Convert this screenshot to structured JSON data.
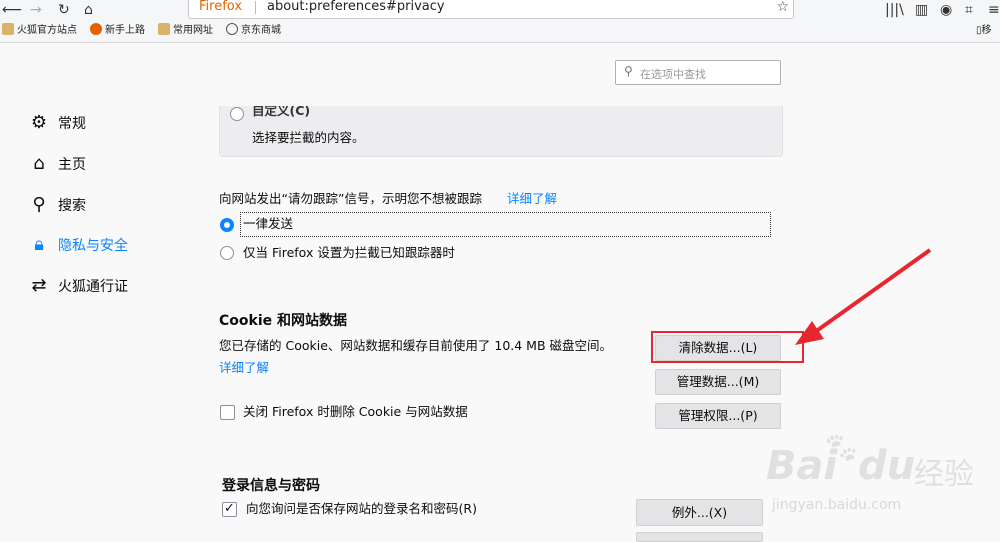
{
  "browser": {
    "brand": "Firefox",
    "url": "about:preferences#privacy",
    "bookmarks": [
      {
        "label": "火狐官方站点",
        "icon": "folder-icon"
      },
      {
        "label": "新手上路",
        "icon": "firefox-icon"
      },
      {
        "label": "常用网址",
        "icon": "folder-icon"
      },
      {
        "label": "京东商城",
        "icon": "globe-icon"
      }
    ],
    "bookmarks_right": "移"
  },
  "search": {
    "placeholder": "在选项中查找"
  },
  "sidebar": {
    "items": [
      {
        "label": "常规",
        "icon": "gear-icon"
      },
      {
        "label": "主页",
        "icon": "home-icon"
      },
      {
        "label": "搜索",
        "icon": "search-icon"
      },
      {
        "label": "隐私与安全",
        "icon": "lock-icon",
        "selected": true
      },
      {
        "label": "火狐通行证",
        "icon": "sync-icon"
      }
    ]
  },
  "blocking": {
    "custom_label": "自定义(C)",
    "custom_desc": "选择要拦截的内容。"
  },
  "dnt": {
    "intro": "向网站发出“请勿跟踪”信号，示明您不想被跟踪",
    "learn_more": "详细了解",
    "option_always": "一律发送",
    "option_only": "仅当 Firefox 设置为拦截已知跟踪器时",
    "selected": "一律发送"
  },
  "cookies": {
    "heading": "Cookie 和网站数据",
    "usage_text": "您已存储的 Cookie、网站数据和缓存目前使用了 10.4 MB 磁盘空间。",
    "learn_more": "详细了解",
    "clear_button": "清除数据...(L)",
    "manage_button": "管理数据...(M)",
    "permissions_button": "管理权限...(P)",
    "delete_on_close": "关闭 Firefox 时删除 Cookie 与网站数据",
    "delete_on_close_checked": false
  },
  "logins": {
    "heading": "登录信息与密码",
    "ask_save": "向您询问是否保存网站的登录名和密码(R)",
    "ask_save_checked": true,
    "exceptions_button": "例外...(X)"
  },
  "watermark": {
    "brand": "Bai",
    "brand2": "du",
    "cn": "经验",
    "url": "jingyan.baidu.com"
  },
  "colors": {
    "accent": "#0a84ff",
    "annotation": "#e8262f"
  }
}
